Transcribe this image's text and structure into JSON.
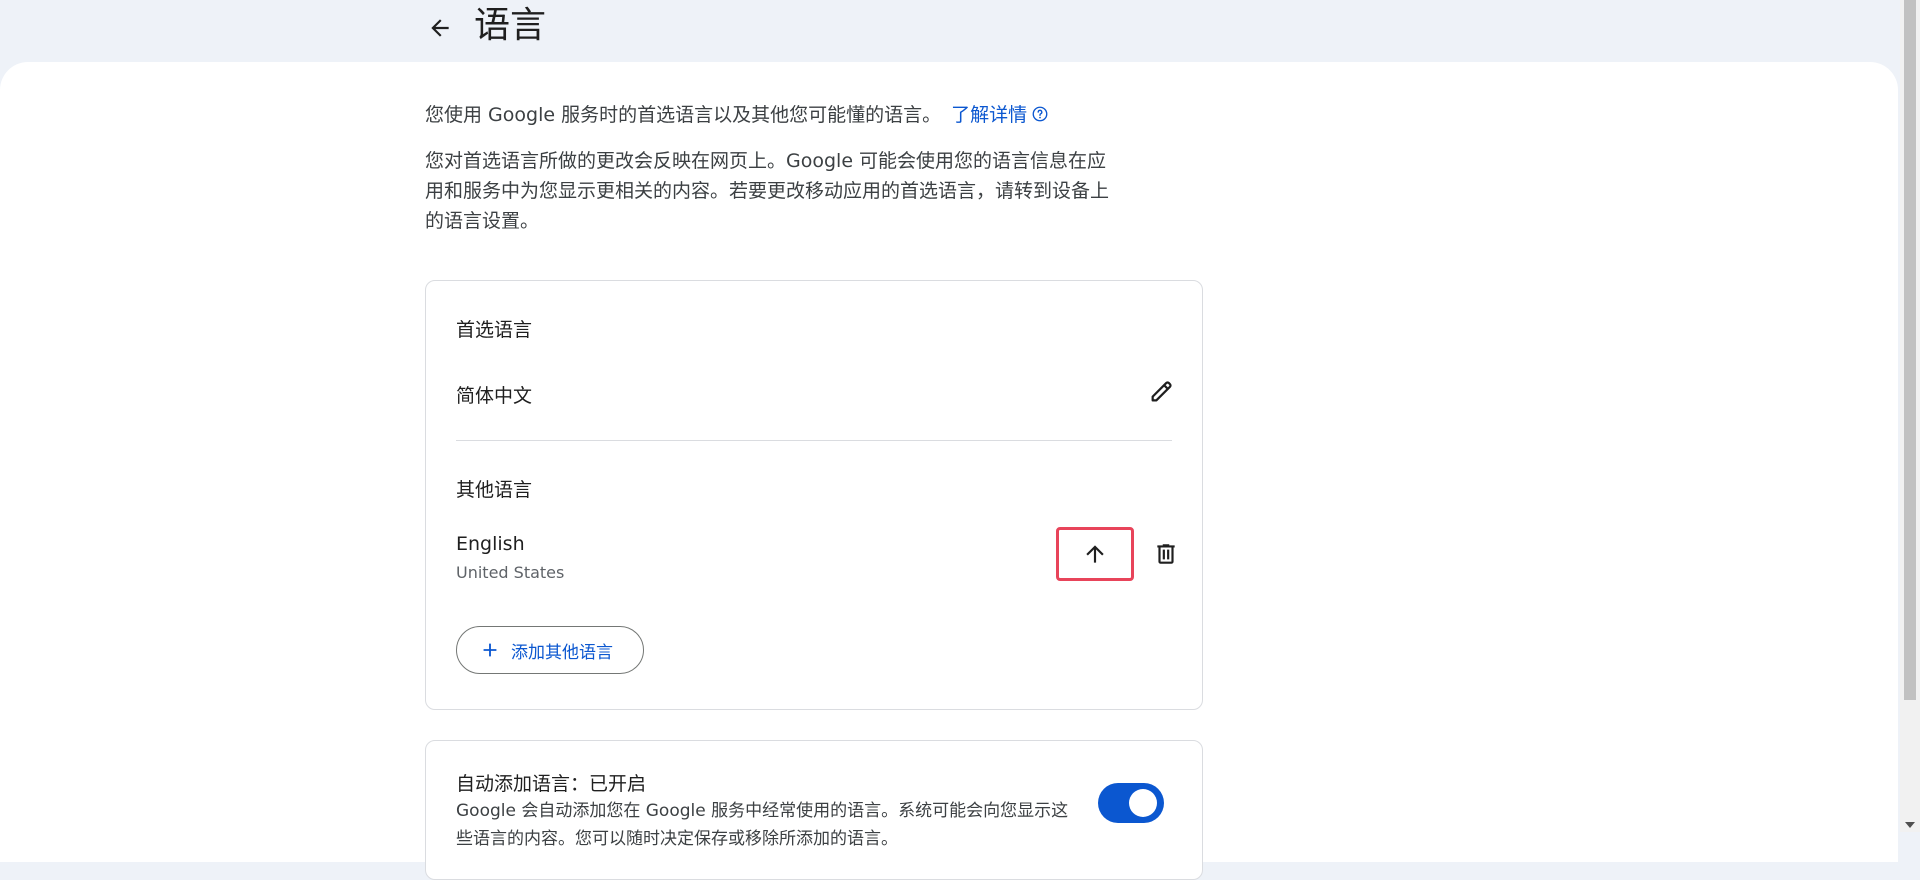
{
  "header": {
    "title": "语言",
    "back_icon": "arrow-back-icon"
  },
  "intro": {
    "line1": "您使用 Google 服务时的首选语言以及其他您可能懂的语言。",
    "learn_more": "了解详情",
    "help_icon": "help-circle-icon",
    "paragraph": "您对首选语言所做的更改会反映在网页上。Google 可能会使用您的语言信息在应用和服务中为您显示更相关的内容。若要更改移动应用的首选语言，请转到设备上的语言设置。"
  },
  "languages": {
    "preferred_heading": "首选语言",
    "preferred_value": "简体中文",
    "edit_icon": "pencil-icon",
    "other_heading": "其他语言",
    "other": [
      {
        "name": "English",
        "region": "United States",
        "move_up_icon": "arrow-up-icon",
        "delete_icon": "trash-icon"
      }
    ],
    "add_button_label": "添加其他语言",
    "add_icon": "plus-icon"
  },
  "auto_add": {
    "heading": "自动添加语言：已开启",
    "description": "Google 会自动添加您在 Google 服务中经常使用的语言。系统可能会向您显示这些语言的内容。您可以随时决定保存或移除所添加的语言。",
    "toggle_on": true
  },
  "colors": {
    "accent": "#0b57d0",
    "highlight_border": "#e8445a",
    "background": "#eef2f8"
  }
}
